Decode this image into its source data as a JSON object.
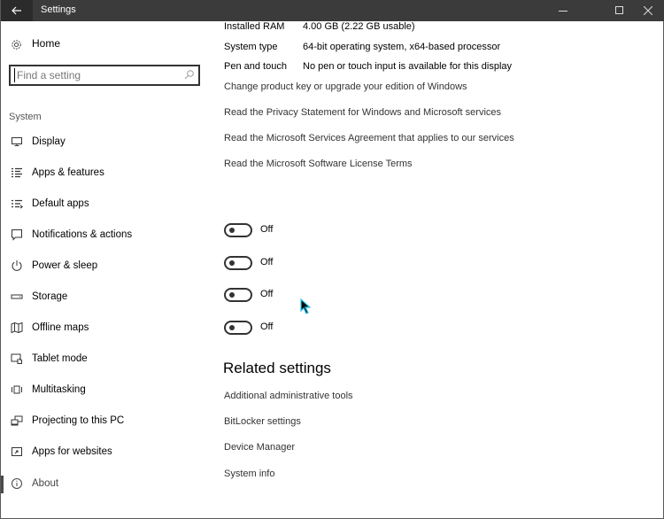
{
  "window": {
    "title": "Settings",
    "controls": {
      "back": "back-arrow-icon",
      "minimize": "minimize-icon",
      "maximize": "maximize-icon",
      "close": "close-icon"
    }
  },
  "sidebar": {
    "home_label": "Home",
    "search_placeholder": "Find a setting",
    "section_label": "System",
    "items": [
      {
        "label": "Display",
        "icon": "monitor-icon"
      },
      {
        "label": "Apps & features",
        "icon": "list-icon"
      },
      {
        "label": "Default apps",
        "icon": "default-apps-icon"
      },
      {
        "label": "Notifications & actions",
        "icon": "notification-icon"
      },
      {
        "label": "Power & sleep",
        "icon": "power-icon"
      },
      {
        "label": "Storage",
        "icon": "storage-icon"
      },
      {
        "label": "Offline maps",
        "icon": "map-icon"
      },
      {
        "label": "Tablet mode",
        "icon": "tablet-mode-icon"
      },
      {
        "label": "Multitasking",
        "icon": "multitasking-icon"
      },
      {
        "label": "Projecting to this PC",
        "icon": "projecting-icon"
      },
      {
        "label": "Apps for websites",
        "icon": "apps-for-websites-icon"
      },
      {
        "label": "About",
        "icon": "info-icon",
        "active": true
      }
    ]
  },
  "main": {
    "specs": [
      {
        "key": "Installed RAM",
        "value": "4.00 GB (2.22 GB usable)"
      },
      {
        "key": "System type",
        "value": "64-bit operating system, x64-based processor"
      },
      {
        "key": "Pen and touch",
        "value": "No pen or touch input is available for this display"
      }
    ],
    "links": [
      "Change product key or upgrade your edition of Windows",
      "Read the Privacy Statement for Windows and Microsoft services",
      "Read the Microsoft Services Agreement that applies to our services",
      "Read the Microsoft Software License Terms"
    ],
    "toggles": [
      {
        "state": "Off",
        "on": false
      },
      {
        "state": "Off",
        "on": false
      },
      {
        "state": "Off",
        "on": false
      },
      {
        "state": "Off",
        "on": false
      }
    ],
    "related": {
      "title": "Related settings",
      "links": [
        "Additional administrative tools",
        "BitLocker settings",
        "Device Manager",
        "System info"
      ]
    }
  }
}
